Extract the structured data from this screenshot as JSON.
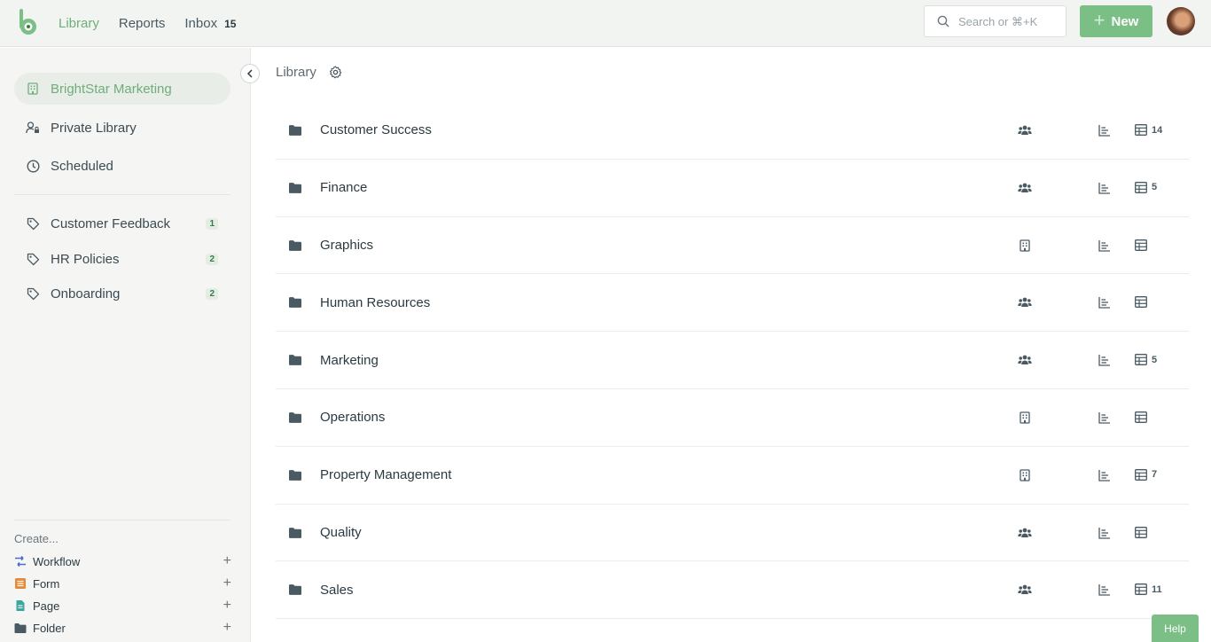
{
  "header": {
    "nav": [
      {
        "label": "Library",
        "count": ""
      },
      {
        "label": "Reports",
        "count": ""
      },
      {
        "label": "Inbox",
        "count": "15"
      }
    ],
    "search_placeholder": "Search or ⌘+K",
    "new_label": "New"
  },
  "sidebar": {
    "primary": [
      {
        "label": "BrightStar Marketing",
        "icon": "building-icon"
      },
      {
        "label": "Private Library",
        "icon": "user-lock-icon"
      },
      {
        "label": "Scheduled",
        "icon": "clock-icon"
      }
    ],
    "tags": [
      {
        "label": "Customer Feedback",
        "count": "1"
      },
      {
        "label": "HR Policies",
        "count": "2"
      },
      {
        "label": "Onboarding",
        "count": "2"
      }
    ],
    "create_label": "Create...",
    "create_items": [
      {
        "label": "Workflow",
        "color": "#4a6cd4"
      },
      {
        "label": "Form",
        "color": "#e8893a"
      },
      {
        "label": "Page",
        "color": "#3aa7a0"
      },
      {
        "label": "Folder",
        "color": "#4a5a63"
      }
    ]
  },
  "main": {
    "breadcrumb": "Library",
    "folders": [
      {
        "name": "Customer Success",
        "access": "team",
        "count": "14"
      },
      {
        "name": "Finance",
        "access": "team",
        "count": "5"
      },
      {
        "name": "Graphics",
        "access": "building",
        "count": ""
      },
      {
        "name": "Human Resources",
        "access": "team",
        "count": ""
      },
      {
        "name": "Marketing",
        "access": "team",
        "count": "5"
      },
      {
        "name": "Operations",
        "access": "building",
        "count": ""
      },
      {
        "name": "Property Management",
        "access": "building",
        "count": "7"
      },
      {
        "name": "Quality",
        "access": "team",
        "count": ""
      },
      {
        "name": "Sales",
        "access": "team",
        "count": "11"
      }
    ]
  },
  "help_label": "Help",
  "colors": {
    "accent": "#7bbf86",
    "accent_text": "#6fae7b"
  }
}
